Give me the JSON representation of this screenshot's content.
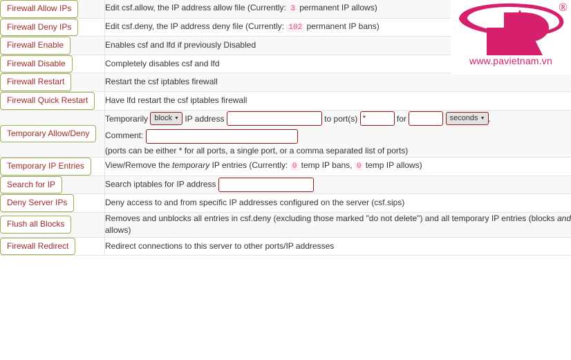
{
  "table": {
    "rows": [
      {
        "button": "Firewall Allow IPs",
        "button_name": "firewall-allow-ips-button",
        "type": "text",
        "desc_pre": "Edit csf.allow, the IP address allow file (Currently:",
        "count": "3",
        "desc_post": "permanent IP allows)"
      },
      {
        "button": "Firewall Deny IPs",
        "button_name": "firewall-deny-ips-button",
        "type": "text",
        "desc_pre": "Edit csf.deny, the IP address deny file (Currently:",
        "count": "102",
        "desc_post": "permanent IP bans)"
      },
      {
        "button": "Firewall Enable",
        "button_name": "firewall-enable-button",
        "type": "plain",
        "desc": "Enables csf and lfd if previously Disabled"
      },
      {
        "button": "Firewall Disable",
        "button_name": "firewall-disable-button",
        "type": "plain",
        "desc": "Completely disables csf and lfd"
      },
      {
        "button": "Firewall Restart",
        "button_name": "firewall-restart-button",
        "type": "plain",
        "desc": "Restart the csf iptables firewall"
      },
      {
        "button": "Firewall Quick Restart",
        "button_name": "firewall-quick-restart-button",
        "type": "plain",
        "desc": "Have lfd restart the csf iptables firewall"
      },
      {
        "button": "Temporary Allow/Deny",
        "button_name": "temporary-allow-deny-button",
        "type": "form"
      },
      {
        "button": "Temporary IP Entries",
        "button_name": "temporary-ip-entries-button",
        "type": "temp-entries",
        "desc_pre": "View/Remove the",
        "desc_em": "temporary",
        "desc_mid": "IP entries (Currently:",
        "count_bans": "0",
        "desc_mid2": "temp IP bans,",
        "count_allows": "0",
        "desc_post": "temp IP allows)"
      },
      {
        "button": "Search for IP",
        "button_name": "search-for-ip-button",
        "type": "search",
        "label": "Search iptables for IP address",
        "input_value": ""
      },
      {
        "button": "Deny Server IPs",
        "button_name": "deny-server-ips-button",
        "type": "plain",
        "desc": "Deny access to and from specific IP addresses configured on the server (csf.sips)"
      },
      {
        "button": "Flush all Blocks",
        "button_name": "flush-all-blocks-button",
        "type": "flush",
        "desc_pre": "Removes and unblocks all entries in csf.deny (excluding those marked \"do not delete\") and all temporary IP entries (blocks",
        "desc_em": "and",
        "desc_post": "allows)"
      },
      {
        "button": "Firewall Redirect",
        "button_name": "firewall-redirect-button",
        "type": "plain",
        "desc": "Redirect connections to this server to other ports/IP addresses"
      }
    ]
  },
  "temp_form": {
    "label_temporarily": "Temporarily",
    "action_select": "block",
    "label_ip_address": "IP address",
    "ip_value": "",
    "label_to_ports": "to port(s)",
    "ports_value": "*",
    "label_for": "for",
    "duration_value": "",
    "unit_select": "seconds",
    "label_period": ".",
    "label_comment": "Comment:",
    "comment_value": "",
    "hint": "(ports can be either * for all ports, a single port, or a comma separated list of ports)",
    "caret_glyph": "▼"
  },
  "logo": {
    "url_text": "www.pavietnam.vn",
    "registered_glyph": "®",
    "brand_color": "#d6206e"
  },
  "colors": {
    "button_border": "#9bad4e",
    "button_text": "#a32929",
    "input_border": "#8e1b1b",
    "count_text": "#e0457b",
    "count_bg": "#fdf0f4",
    "row_odd": "#f8f8f8",
    "row_even": "#ffffff",
    "row_border": "#e3e3e3"
  }
}
